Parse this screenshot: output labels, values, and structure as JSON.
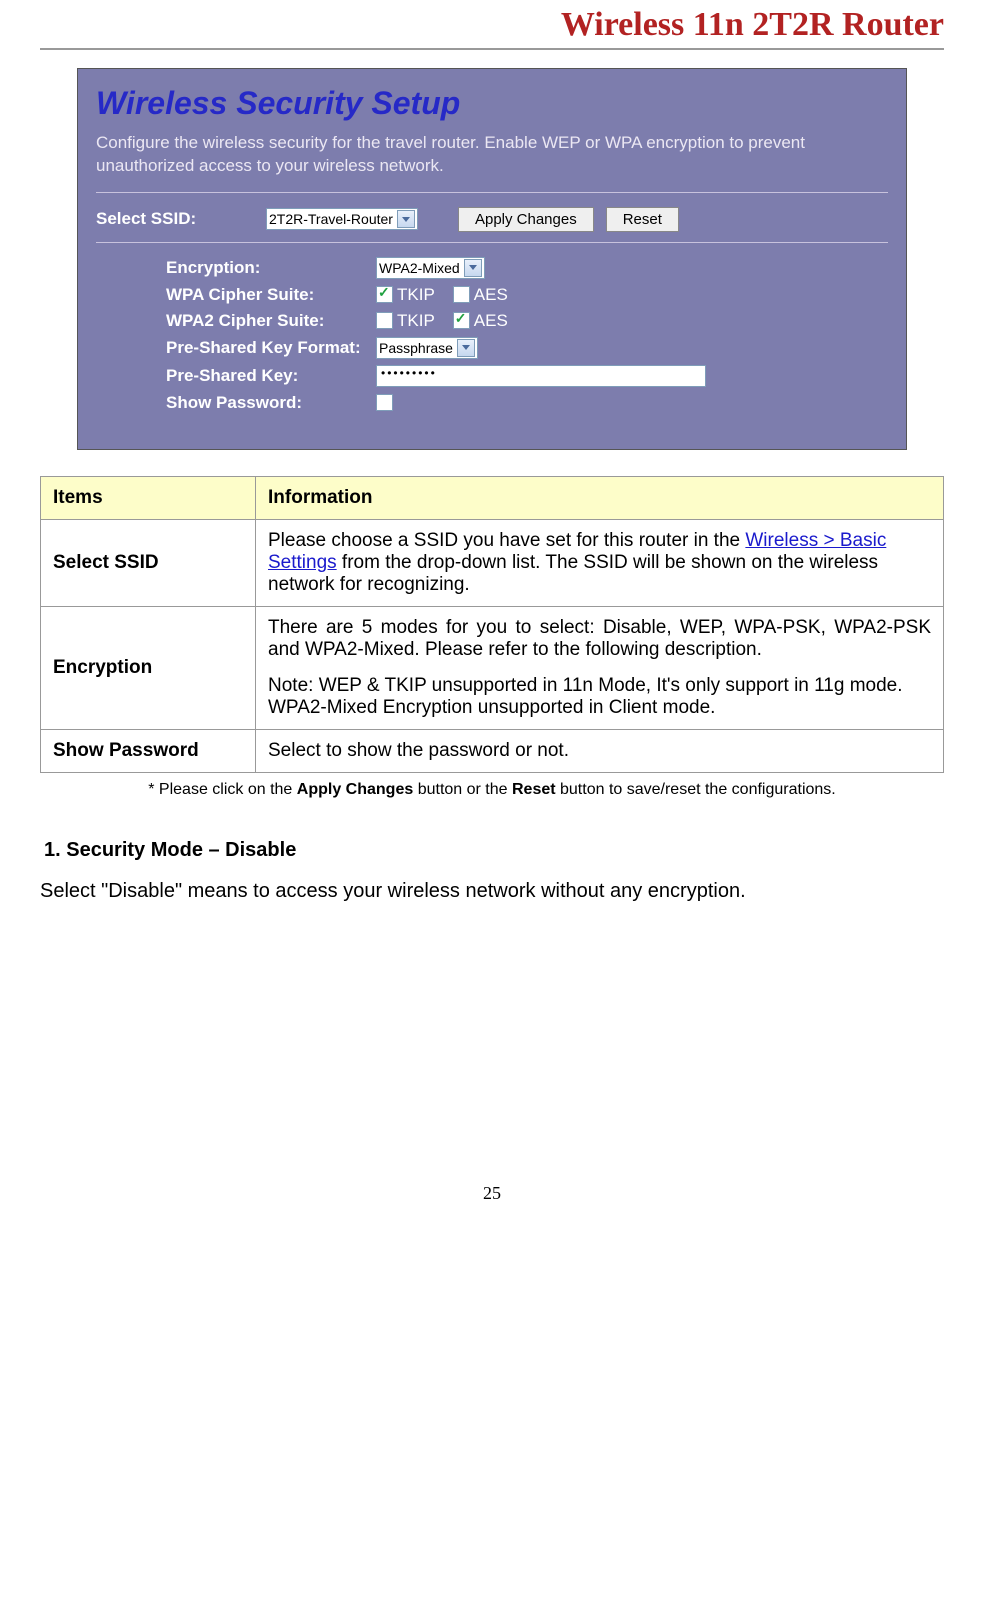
{
  "doc": {
    "header_title": "Wireless 11n 2T2R Router",
    "page_number": "25"
  },
  "panel": {
    "title": "Wireless Security Setup",
    "description": "Configure the wireless security for the travel router. Enable WEP or WPA encryption to prevent unauthorized access to your wireless network.",
    "select_ssid_label": "Select SSID:",
    "select_ssid_value": "2T2R-Travel-Router",
    "btn_apply": "Apply Changes",
    "btn_reset": "Reset",
    "encryption_label": "Encryption:",
    "encryption_value": "WPA2-Mixed",
    "wpa_cipher_label": "WPA Cipher Suite:",
    "wpa2_cipher_label": "WPA2 Cipher Suite:",
    "cb_tkip": "TKIP",
    "cb_aes": "AES",
    "psk_format_label": "Pre-Shared Key Format:",
    "psk_format_value": "Passphrase",
    "psk_label": "Pre-Shared Key:",
    "psk_value": "•••••••••",
    "show_pw_label": "Show Password:",
    "wpa_tkip_checked": true,
    "wpa_aes_checked": false,
    "wpa2_tkip_checked": false,
    "wpa2_aes_checked": true,
    "show_pw_checked": false
  },
  "table": {
    "head_items": "Items",
    "head_info": "Information",
    "rows": [
      {
        "item": "Select SSID",
        "info_pre": "Please choose a SSID you have set for this router in the ",
        "link": "Wireless > Basic Settings",
        "info_post": " from the drop-down list. The SSID will be shown on the wireless network for recognizing."
      },
      {
        "item": "Encryption",
        "p1": "There are 5 modes for you to select: Disable, WEP, WPA-PSK, WPA2-PSK and WPA2-Mixed. Please refer to the following description.",
        "p2": "Note: WEP & TKIP unsupported in 11n Mode, It's only support in 11g mode. WPA2-Mixed Encryption unsupported in Client mode."
      },
      {
        "item": "Show Password",
        "p1": "Select to show the password or not."
      }
    ]
  },
  "footnote": {
    "pre": "* Please click on the ",
    "b1": "Apply Changes",
    "mid": " button or the ",
    "b2": "Reset",
    "post": " button to save/reset the configurations."
  },
  "section": {
    "heading": "1.   Security Mode – Disable",
    "para": "Select \"Disable\" means to access your wireless network without any encryption."
  }
}
